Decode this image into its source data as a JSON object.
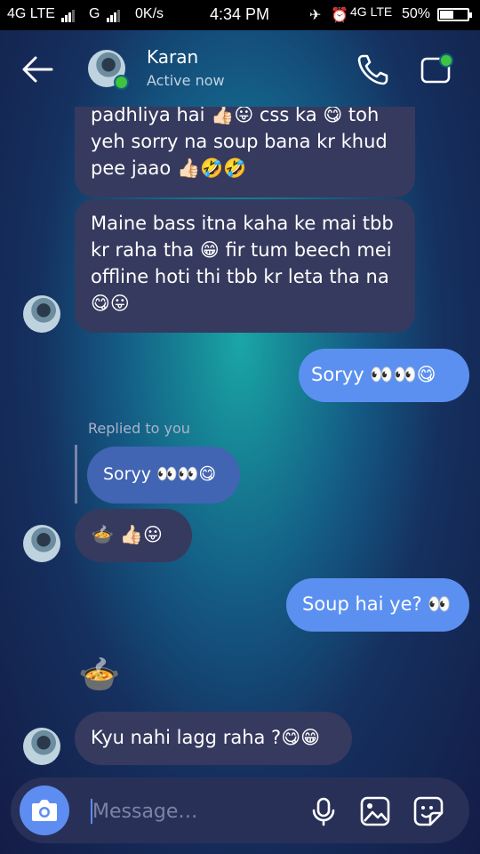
{
  "status_bar": {
    "network1": "4G LTE",
    "network2": "G",
    "speed": "0K/s",
    "time": "4:34 PM",
    "network3": "4G LTE",
    "battery": "50%",
    "battery_level": 0.5
  },
  "header": {
    "name": "Karan",
    "status": "Active now"
  },
  "messages": [
    {
      "text": "padhliya hai 👍🏻😛 css ka 😋 toh yeh sorry na soup bana kr khud pee jaao 👍🏻🤣🤣"
    },
    {
      "text": "Maine bass itna kaha ke mai tbb kr raha tha 😁 fir tum beech mei offline hoti thi tbb kr leta tha na 😋😛"
    },
    {
      "text": "Soryy 👀👀😋"
    },
    {
      "reply_label": "Replied to you",
      "text": "Soryy 👀👀😋"
    },
    {
      "text": "🍲 👍🏻😛"
    },
    {
      "text": "Soup hai ye? 👀"
    },
    {
      "text": "🍲"
    },
    {
      "text": "Kyu nahi lagg raha ?😋😁"
    }
  ],
  "composer": {
    "placeholder": "Message…"
  },
  "icons": [
    "back-arrow-icon",
    "phone-icon",
    "video-call-icon",
    "camera-icon",
    "microphone-icon",
    "gallery-icon",
    "sticker-icon"
  ]
}
